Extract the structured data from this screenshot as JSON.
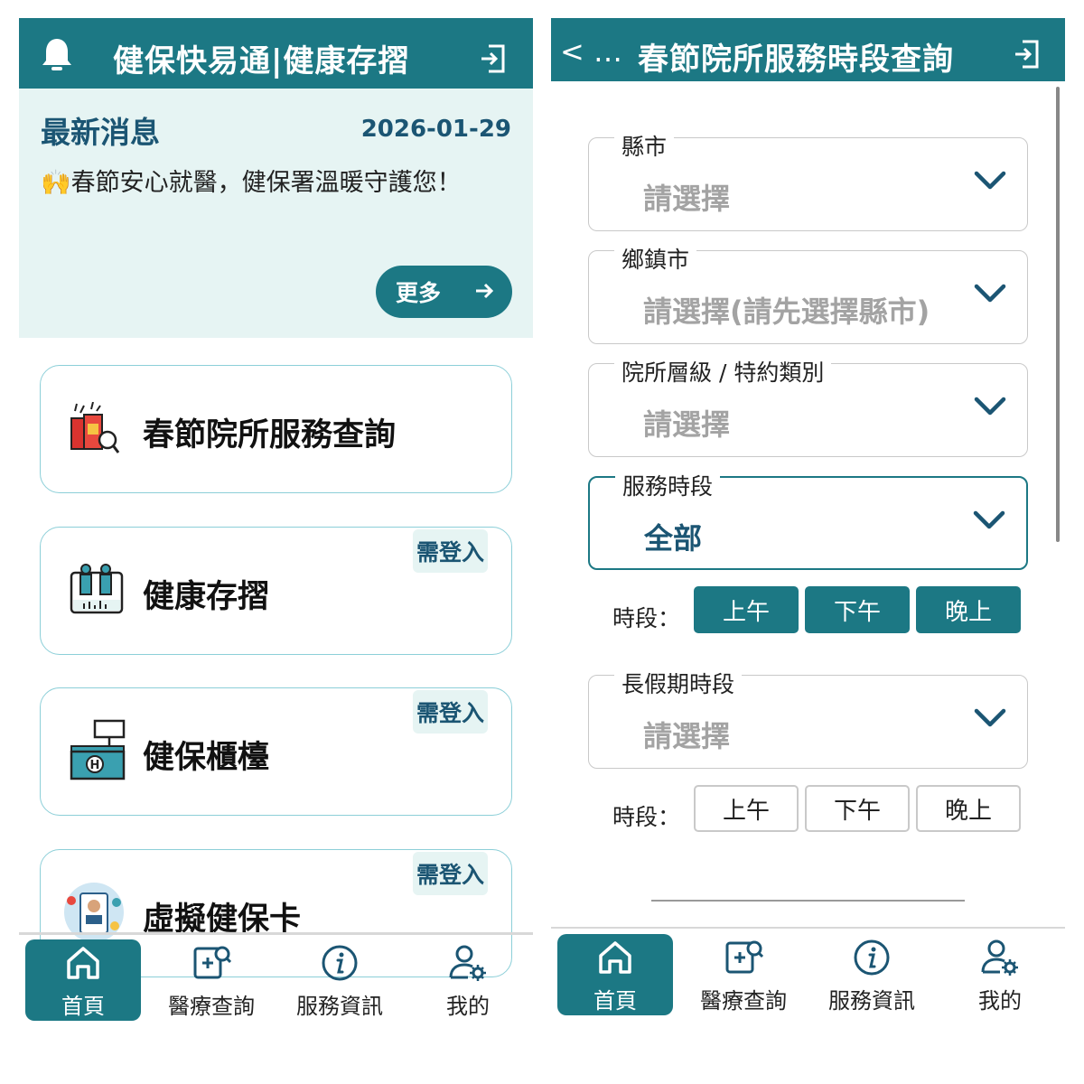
{
  "left": {
    "header": {
      "title": "健保快易通|健康存摺",
      "bell_icon": "bell-icon",
      "logout_icon": "logout-icon"
    },
    "news": {
      "heading": "最新消息",
      "date": "2026-01-29",
      "emoji": "🙌",
      "body": "春節安心就醫，健保署溫暖守護您！",
      "more_label": "更多",
      "arrow_icon": "arrow-right-icon"
    },
    "cards": [
      {
        "label": "春節院所服務查詢",
        "icon": "new-year-search-icon",
        "login_tag": ""
      },
      {
        "label": "健康存摺",
        "icon": "health-passbook-icon",
        "login_tag": "需登入"
      },
      {
        "label": "健保櫃檯",
        "icon": "counter-icon",
        "login_tag": "需登入"
      },
      {
        "label": "虛擬健保卡",
        "icon": "virtual-card-icon",
        "login_tag": "需登入"
      }
    ]
  },
  "right": {
    "header": {
      "back_label": "< …",
      "title": "春節院所服務時段查詢",
      "logout_icon": "logout-icon"
    },
    "fields": [
      {
        "label": "縣市",
        "value": "請選擇"
      },
      {
        "label": "鄉鎮市",
        "value": "請選擇(請先選擇縣市)"
      },
      {
        "label": "院所層級 / 特約類別",
        "value": "請選擇"
      },
      {
        "label": "服務時段",
        "value": "全部"
      },
      {
        "label": "長假期時段",
        "value": "請選擇"
      }
    ],
    "period_rows": [
      {
        "label": "時段：",
        "options": [
          "上午",
          "下午",
          "晚上"
        ],
        "selected": [
          true,
          true,
          true
        ]
      },
      {
        "label": "時段：",
        "options": [
          "上午",
          "下午",
          "晚上"
        ],
        "selected": [
          false,
          false,
          false
        ]
      }
    ]
  },
  "tabbar": [
    {
      "label": "首頁",
      "icon": "home-icon",
      "active": true
    },
    {
      "label": "醫療查詢",
      "icon": "medical-search-icon",
      "active": false
    },
    {
      "label": "服務資訊",
      "icon": "info-icon",
      "active": false
    },
    {
      "label": "我的",
      "icon": "user-settings-icon",
      "active": false
    }
  ],
  "colors": {
    "primary": "#1c7884",
    "news_bg": "#e6f4f3",
    "heading": "#1b5573",
    "card_border": "#8ccfd8"
  }
}
